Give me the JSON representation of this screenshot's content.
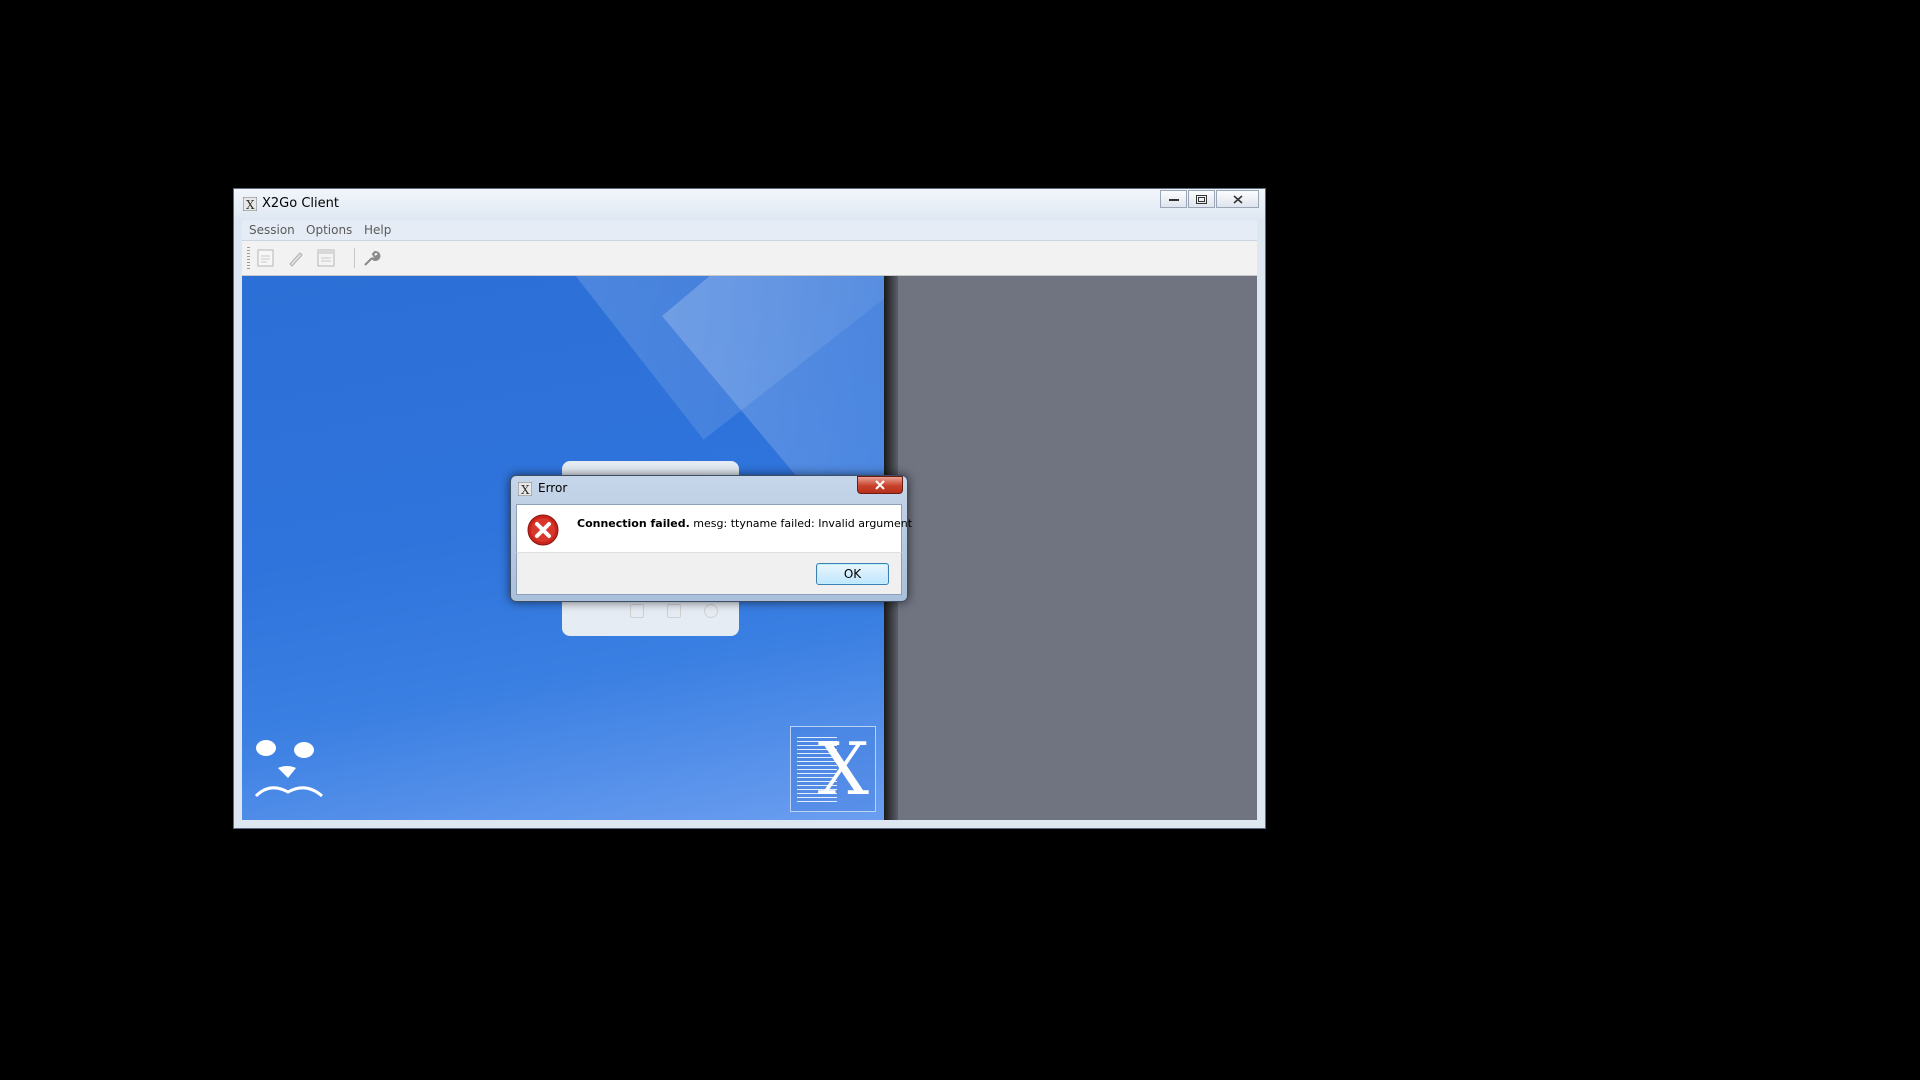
{
  "window": {
    "title": "X2Go Client",
    "menu": [
      "Session",
      "Options",
      "Help"
    ]
  },
  "toolbar": {
    "icons": [
      "new-session-icon",
      "edit-session-icon",
      "session-list-icon",
      "settings-wrench-icon"
    ]
  },
  "dialog": {
    "title": "Error",
    "message_bold": "Connection failed.",
    "message": " mesg: ttyname failed: Invalid argument",
    "ok_label": "OK"
  },
  "colors": {
    "desktop_blue": "#2f74dc",
    "right_panel_gray": "#707380",
    "error_red": "#c8241c"
  }
}
